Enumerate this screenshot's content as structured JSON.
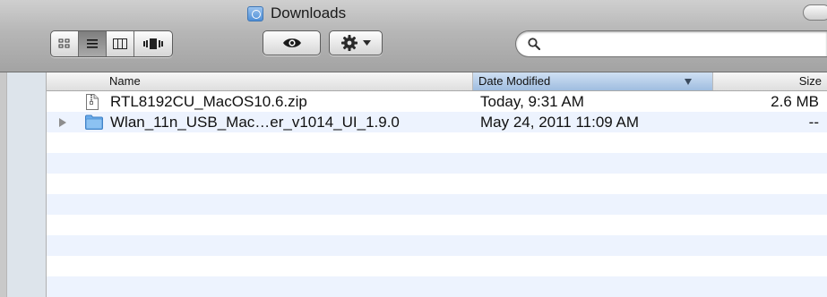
{
  "window": {
    "title": "Downloads"
  },
  "toolbar": {
    "view_modes": [
      {
        "name": "icon-view",
        "active": false
      },
      {
        "name": "list-view",
        "active": true
      },
      {
        "name": "column-view",
        "active": false
      },
      {
        "name": "cover-flow-view",
        "active": false
      }
    ],
    "quick_look_icon": "eye-icon",
    "action_icon": "gear-icon",
    "search": {
      "value": "",
      "placeholder": ""
    }
  },
  "table": {
    "columns": {
      "name": "Name",
      "date": "Date Modified",
      "size": "Size"
    },
    "sorted_by": "date",
    "sort_direction": "descending",
    "rows": [
      {
        "name": "RTL8192CU_MacOS10.6.zip",
        "date": "Today, 9:31 AM",
        "size": "2.6 MB",
        "kind": "zip",
        "expandable": false
      },
      {
        "name": "Wlan_11n_USB_Mac…er_v1014_UI_1.9.0",
        "date": "May 24, 2011 11:09 AM",
        "size": "--",
        "kind": "folder",
        "expandable": true
      }
    ]
  },
  "colors": {
    "alternate_row": "#edf3fe",
    "sorted_header": "#9fbde0",
    "sidebar": "#dde4eb",
    "folder_blue": "#5aa0e6"
  }
}
